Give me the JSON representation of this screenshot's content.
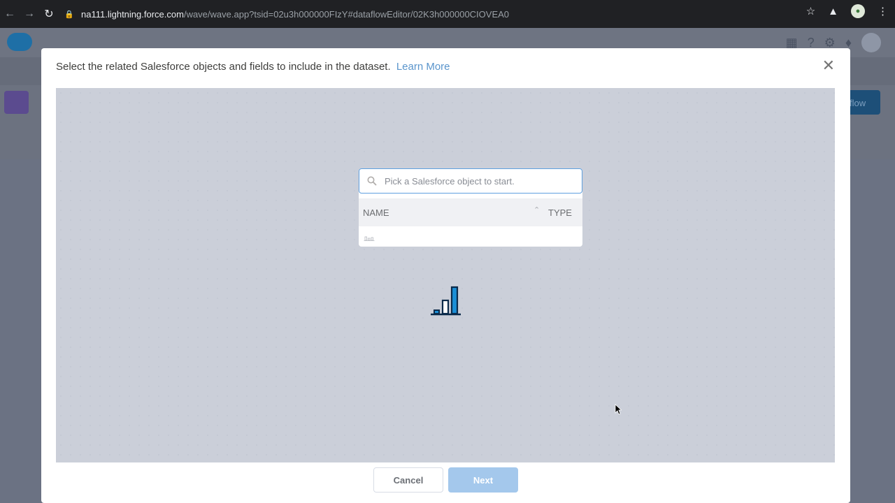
{
  "browser": {
    "url_host": "na111.lightning.force.com",
    "url_path": "/wave/wave.app?tsid=02u3h000000FIzY#dataflowEditor/02K3h000000CIOVEA0"
  },
  "app": {
    "right_button_label": "flow"
  },
  "modal": {
    "header_text": "Select the related Salesforce objects and fields to include in the dataset.",
    "learn_more_label": "Learn More",
    "close_label": "✕",
    "search": {
      "placeholder": "Pick a Salesforce object to start."
    },
    "table": {
      "columns": [
        "NAME",
        "TYPE"
      ]
    },
    "footer": {
      "cancel_label": "Cancel",
      "next_label": "Next"
    }
  },
  "colors": {
    "accent_blue": "#0070d2",
    "link_blue": "#5a95cc",
    "next_disabled": "#a4c8ec"
  }
}
